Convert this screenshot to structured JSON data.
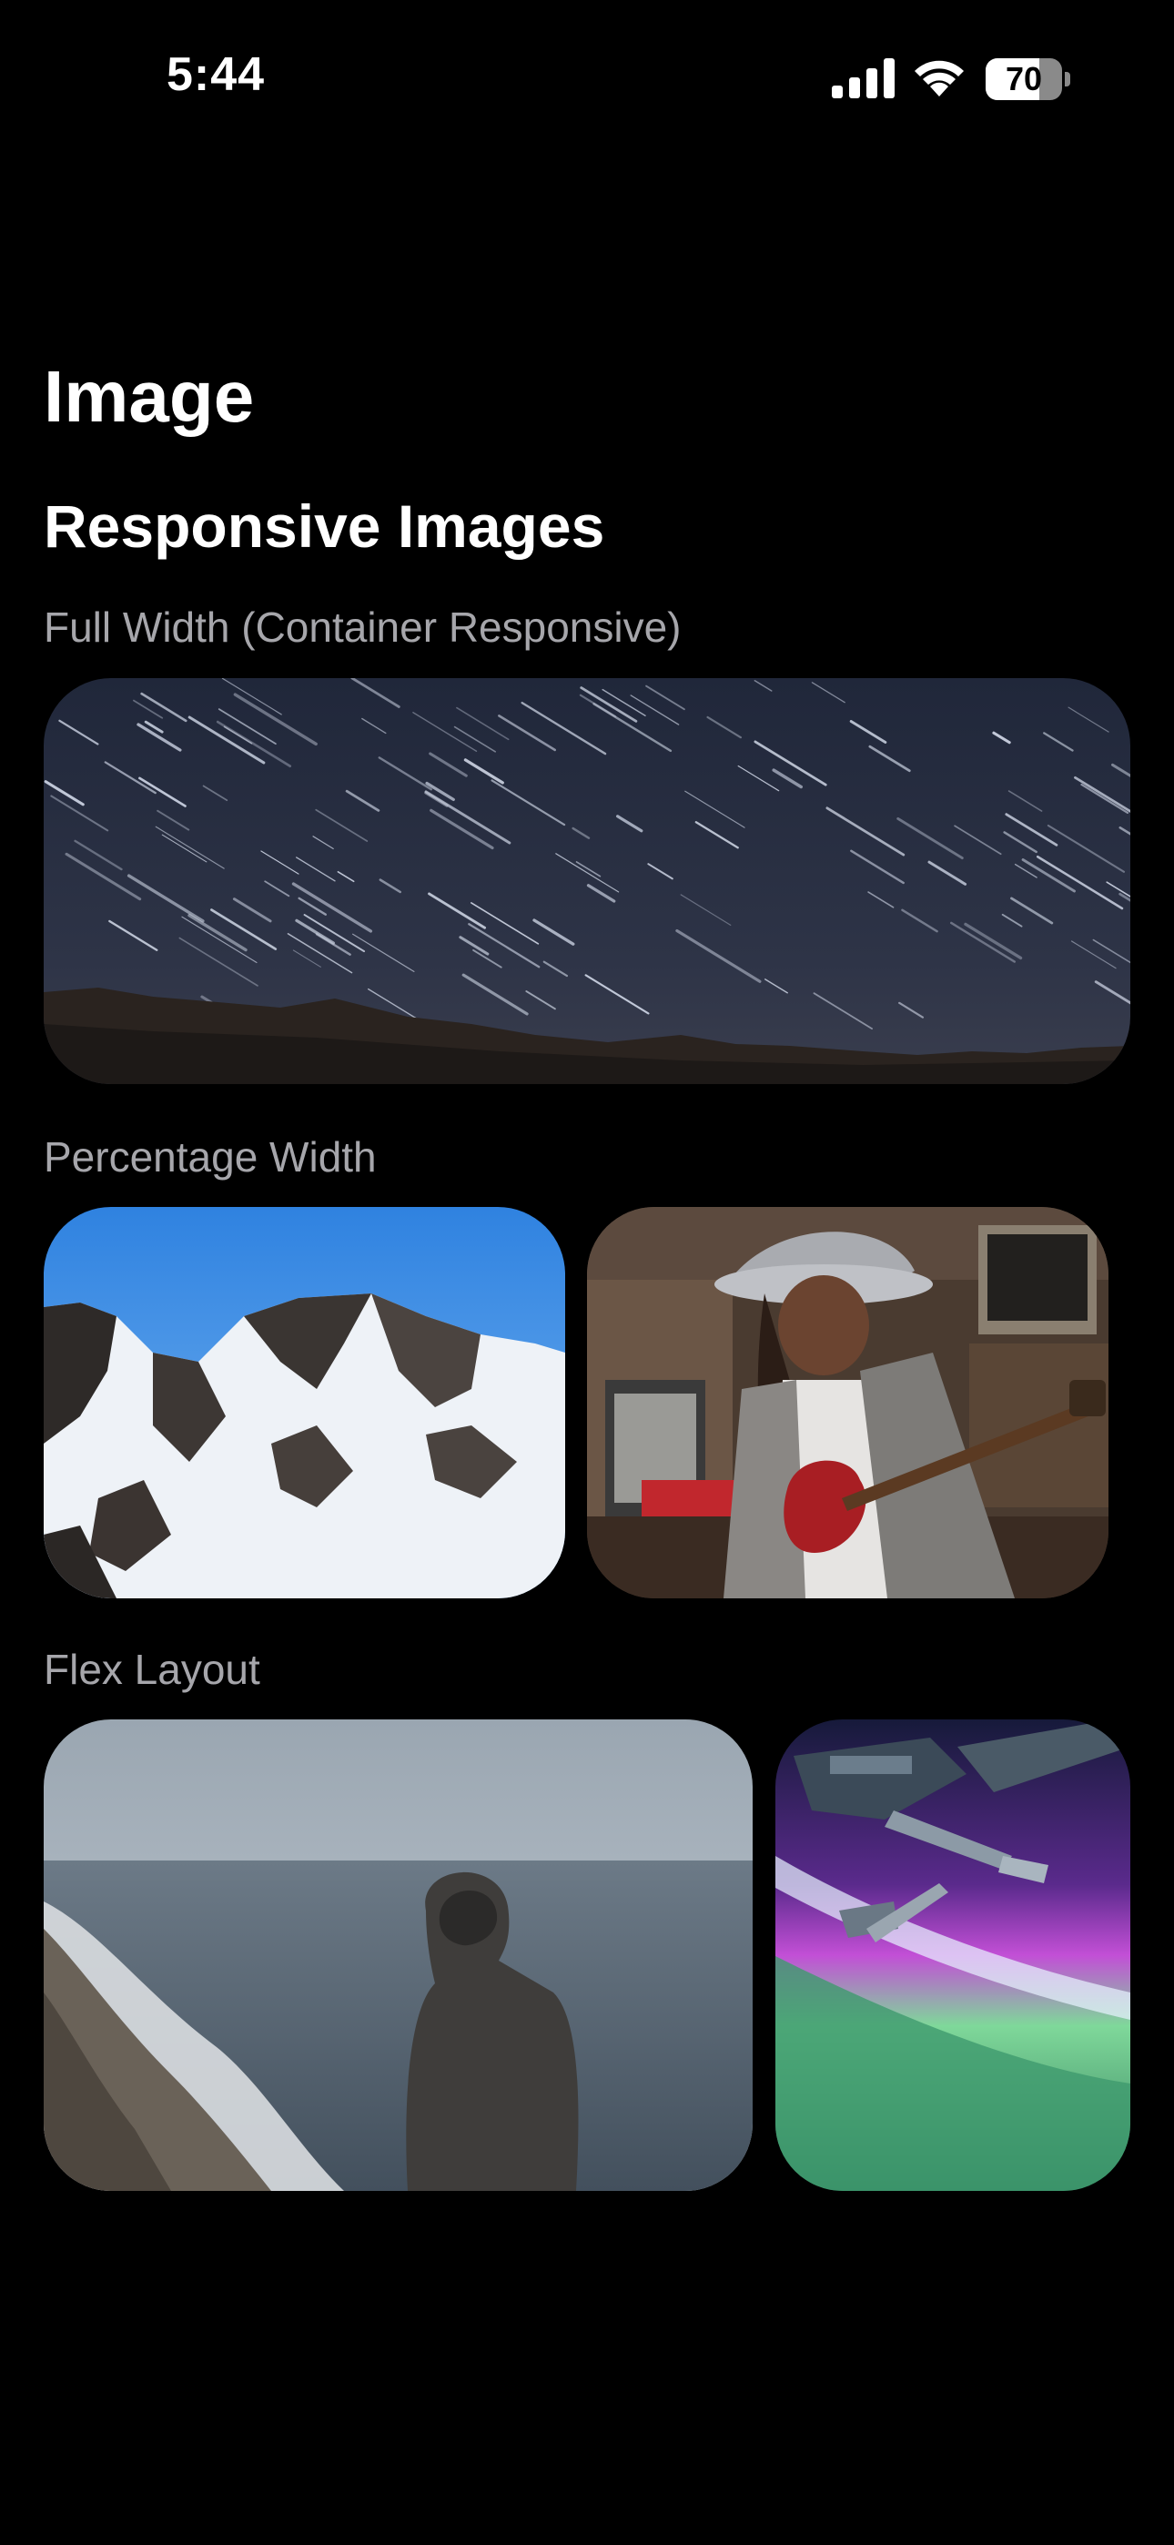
{
  "status_bar": {
    "time": "5:44",
    "battery_level": "70",
    "battery_fraction": 0.7,
    "icons": [
      "signal-bars-icon",
      "wifi-icon",
      "battery-icon"
    ]
  },
  "page": {
    "title": "Image",
    "section_title": "Responsive Images"
  },
  "sections": {
    "full_width": {
      "label": "Full Width (Container Responsive)",
      "images": [
        "star-trails-night-sky-photo"
      ]
    },
    "percentage_width": {
      "label": "Percentage Width",
      "images": [
        "snowy-mountains-photo",
        "woman-playing-guitar-photo"
      ]
    },
    "flex_layout": {
      "label": "Flex Layout",
      "images": [
        "hooded-person-beach-photo",
        "space-station-aurora-photo"
      ]
    }
  },
  "colors": {
    "background": "#000000",
    "text_primary": "#ffffff",
    "text_secondary": "#a6a6ab"
  }
}
